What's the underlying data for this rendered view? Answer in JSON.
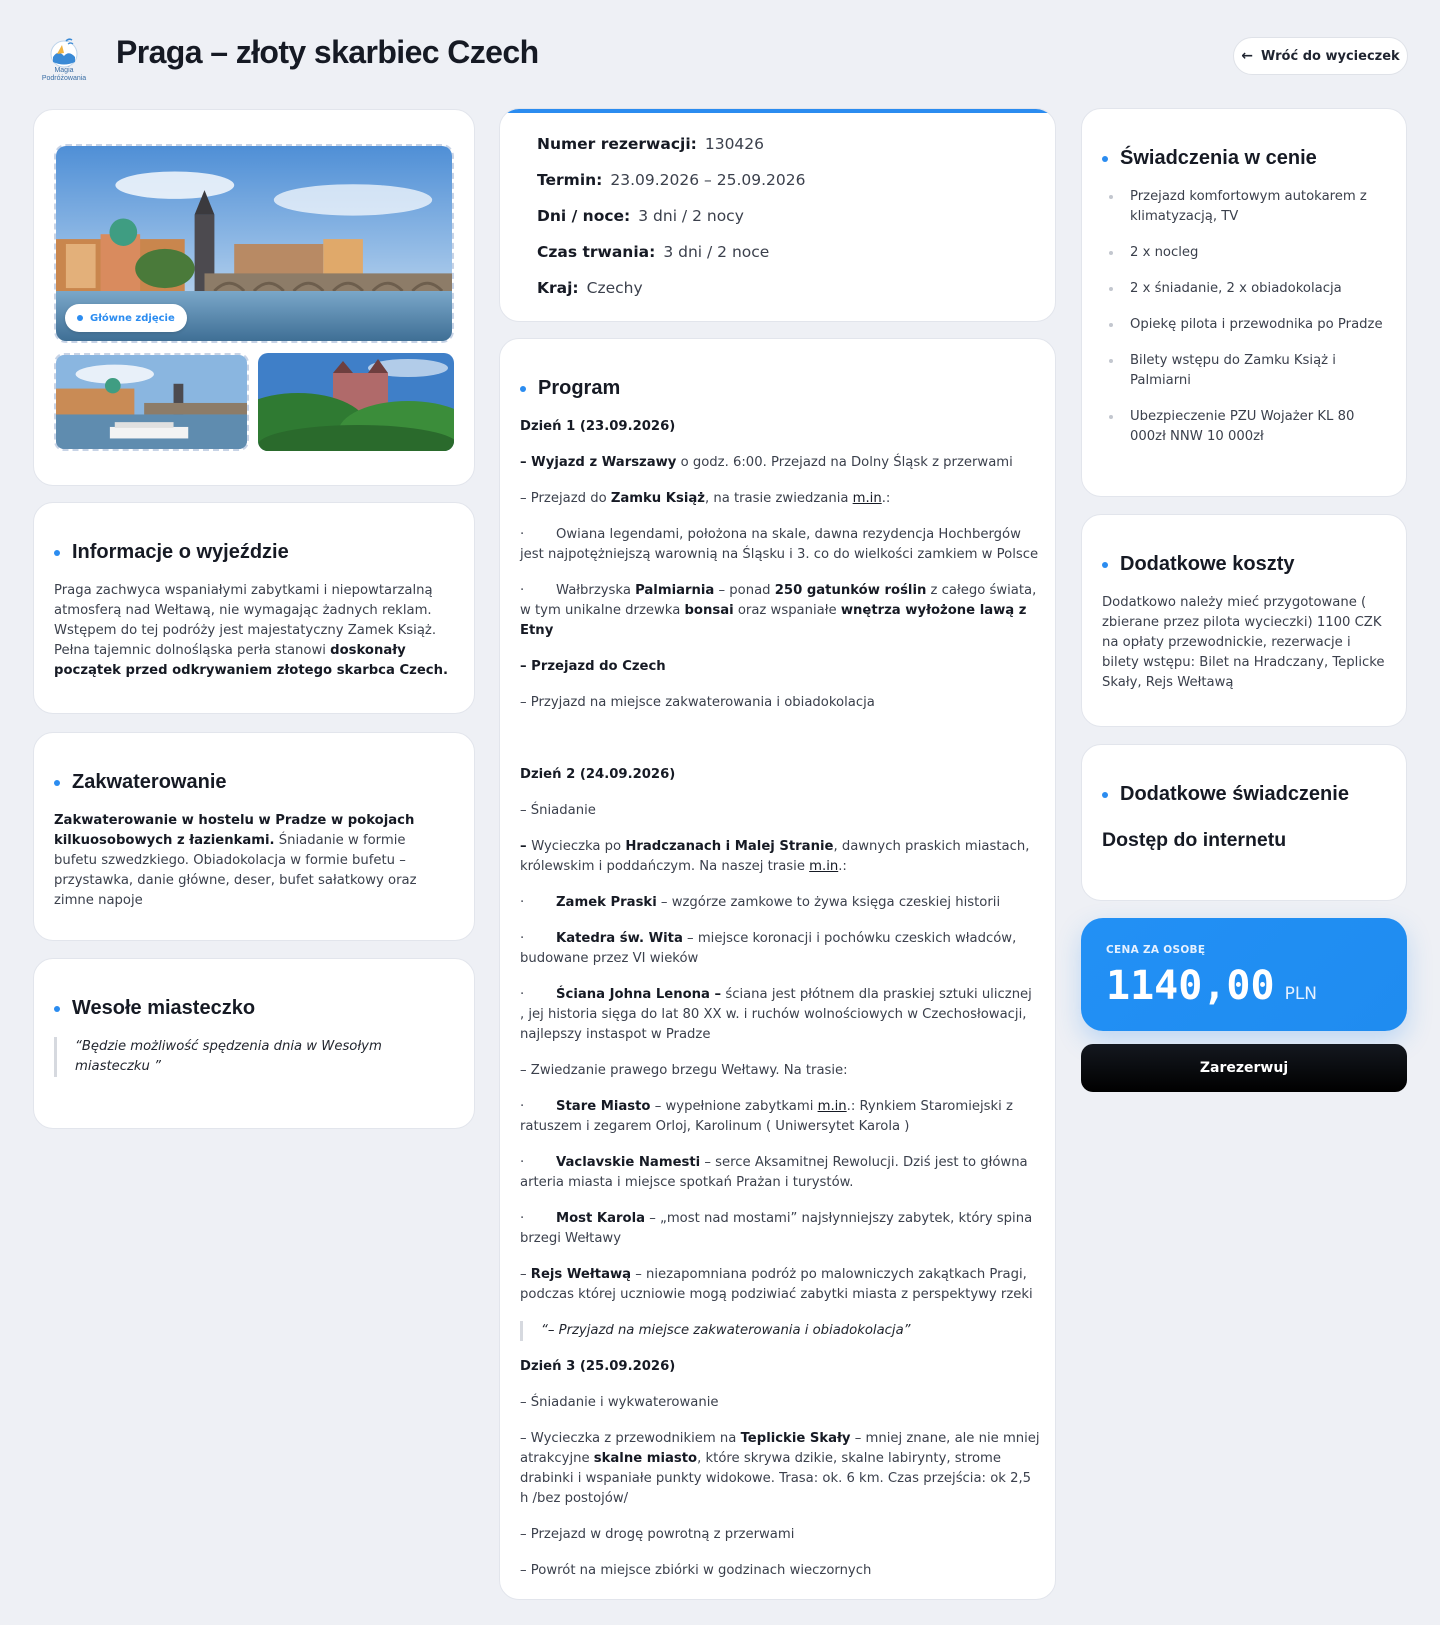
{
  "header": {
    "logo_text": "Magia Podróżowania",
    "title": "Praga – złoty skarbiec Czech",
    "back_label": "Wróć do wycieczek"
  },
  "gallery": {
    "badge": "Główne zdjęcie"
  },
  "info": {
    "title": "Informacje o wyjeździe",
    "text_plain": "Praga zachwyca wspaniałymi zabytkami i niepowtarzalną atmosferą nad Wełtawą, nie wymagając żadnych reklam. Wstępem do tej podróży jest majestatyczny Zamek Książ. Pełna tajemnic dolnośląska perła stanowi ",
    "text_bold": "doskonały początek przed odkrywaniem złotego skarbca Czech."
  },
  "stay": {
    "title": "Zakwaterowanie",
    "text_bold": "Zakwaterowanie w hostelu w Pradze w pokojach kilkuosobowych z łazienkami.",
    "text_plain": " Śniadanie w formie bufetu szwedzkiego. Obiadokolacja w formie bufetu – przystawka, danie główne, deser, bufet sałatkowy oraz zimne napoje"
  },
  "fun": {
    "title": "Wesołe miasteczko",
    "quote": "“Będzie możliwość spędzenia dnia w Wesołym miasteczku ”"
  },
  "booking": {
    "rows": [
      {
        "label": "Numer rezerwacji:",
        "value": "130426"
      },
      {
        "label": "Termin:",
        "value": "23.09.2026 – 25.09.2026"
      },
      {
        "label": "Dni / noce:",
        "value": "3 dni / 2 nocy"
      },
      {
        "label": "Czas trwania:",
        "value": "3 dni / 2 noce"
      },
      {
        "label": "Kraj:",
        "value": "Czechy"
      }
    ]
  },
  "program": {
    "title": "Program",
    "d1": {
      "day": "Dzień 1 (23.09.2026)",
      "l1a": "– Wyjazd z Warszawy",
      "l1b": " o godz. 6:00. Przejazd na Dolny Śląsk z przerwami",
      "l2a": "– Przejazd do ",
      "l2b": "Zamku Książ",
      "l2c": ", na trasie zwiedzania ",
      "l2d": "m.in",
      "l2e": ".:",
      "l3": "Owiana legendami, położona na skale, dawna rezydencja Hochbergów jest najpotężniejszą warownią na Śląsku i 3. co do wielkości zamkiem w Polsce",
      "l4a": "Wałbrzyska ",
      "l4b": "Palmiarnia",
      "l4c": " – ponad ",
      "l4d": "250 gatunków roślin",
      "l4e": " z całego świata, w tym unikalne drzewka ",
      "l4f": "bonsai",
      "l4g": " oraz wspaniałe ",
      "l4h": "wnętrza wyłożone lawą z Etny",
      "l5": "– Przejazd do Czech",
      "l6": "– Przyjazd na miejsce zakwaterowania i obiadokolacja"
    },
    "d2": {
      "day": "Dzień 2 (24.09.2026)",
      "l1": "– Śniadanie",
      "l2a": "– ",
      "l2b": "Wycieczka po ",
      "l2c": "Hradczanach i Malej Stranie",
      "l2d": ", dawnych praskich miastach, królewskim i poddańczym. Na naszej trasie ",
      "l2e": "m.in",
      "l2f": ".:",
      "l3a": "Zamek Praski",
      "l3b": " – wzgórze zamkowe to żywa księga czeskiej historii",
      "l4a": "Katedra św. Wita",
      "l4b": " – miejsce koronacji i pochówku czeskich władców, budowane przez VI wieków",
      "l5a": "Ściana Johna Lenona –",
      "l5b": " ściana jest płótnem dla praskiej sztuki ulicznej , jej historia sięga do lat 80  XX w. i ruchów wolnościowych w Czechosłowacji, najlepszy instaspot w Pradze",
      "l6": "– Zwiedzanie prawego brzegu Wełtawy. Na trasie:",
      "l7a": "Stare Miasto",
      "l7b": " – wypełnione zabytkami ",
      "l7c": "m.in",
      "l7d": ".: Rynkiem Staromiejski z ratuszem   i zegarem Orloj, Karolinum ( Uniwersytet Karola )",
      "l8a": "Vaclavskie Namesti",
      "l8b": " – serce Aksamitnej Rewolucji. Dziś jest to główna arteria miasta i miejsce spotkań Prażan i turystów.",
      "l9a": "Most Karola",
      "l9b": " – „most nad mostami” najsłynniejszy zabytek, który spina brzegi Wełtawy",
      "l10a": "– ",
      "l10b": "Rejs Wełtawą",
      "l10c": " – niezapomniana podróż po malowniczych zakątkach Pragi, podczas której uczniowie mogą podziwiać zabytki miasta z perspektywy rzeki",
      "quote": "“– Przyjazd na miejsce zakwaterowania i obiadokolacja”"
    },
    "d3": {
      "day": "Dzień 3 (25.09.2026)",
      "l1": "– Śniadanie i wykwaterowanie",
      "l2a": "– Wycieczka z przewodnikiem na ",
      "l2b": "Teplickie Skały",
      "l2c": " – mniej znane, ale nie mniej atrakcyjne ",
      "l2d": "skalne miasto",
      "l2e": ", które skrywa dzikie, skalne labirynty, strome drabinki i wspaniałe punkty widokowe. Trasa: ok. 6 km. Czas przejścia: ok 2,5 h /bez postojów/",
      "l3": "– Przejazd w drogę powrotną z przerwami",
      "l4": "– Powrót na miejsce zbiórki w godzinach wieczornych"
    }
  },
  "included": {
    "title": "Świadczenia w cenie",
    "items": [
      "Przejazd komfortowym autokarem z klimatyzacją, TV",
      "2 x nocleg",
      "2 x śniadanie, 2 x obiadokolacja",
      "Opiekę pilota i przewodnika po Pradze",
      "Bilety wstępu do Zamku Książ i Palmiarni",
      "Ubezpieczenie PZU Wojażer KL 80 000zł NNW 10 000zł"
    ]
  },
  "extra": {
    "title": "Dodatkowe koszty",
    "text": "Dodatkowo należy mieć przygotowane ( zbierane przez pilota wycieczki) 1100 CZK na opłaty przewodnickie, rezerwacje i bilety wstępu: Bilet na Hradczany, Teplicke Skały, Rejs Wełtawą"
  },
  "additional": {
    "title": "Dodatkowe świadczenie",
    "text": "Dostęp do internetu"
  },
  "price": {
    "label": "CENA ZA OSOBĘ",
    "amount": "1140,00",
    "currency": "PLN"
  },
  "reserve_label": "Zarezerwuj",
  "colors": {
    "accent": "#2b8cf0",
    "background": "#eef0f5"
  }
}
